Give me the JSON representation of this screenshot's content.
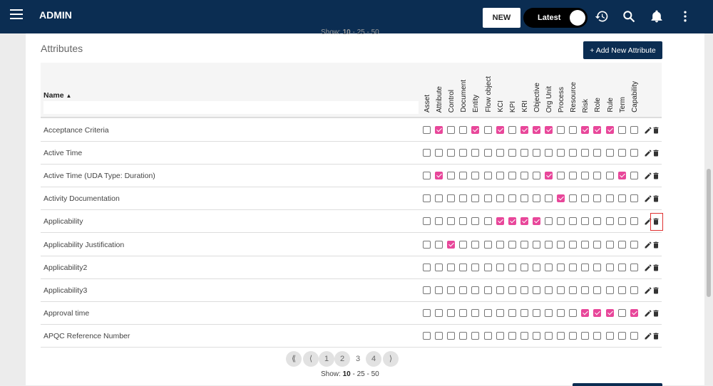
{
  "header": {
    "title": "ADMIN",
    "new_label": "NEW",
    "toggle_label": "Latest"
  },
  "section": {
    "title": "Attributes",
    "add_label": "+ Add New Attribute"
  },
  "table": {
    "name_header": "Name",
    "sort_indicator": "▲",
    "columns": [
      "Asset",
      "Attribute",
      "Control",
      "Document",
      "Entity",
      "Flow object",
      "KCI",
      "KPI",
      "KRI",
      "Objective",
      "Org Unit",
      "Process",
      "Resource",
      "Risk",
      "Role",
      "Rule",
      "Term",
      "Capability"
    ],
    "rows": [
      {
        "name": "Acceptance Criteria",
        "checks": [
          0,
          1,
          0,
          0,
          1,
          0,
          1,
          0,
          1,
          1,
          1,
          0,
          0,
          1,
          1,
          1,
          0,
          0
        ]
      },
      {
        "name": "Active Time",
        "checks": [
          0,
          0,
          0,
          0,
          0,
          0,
          0,
          0,
          0,
          0,
          0,
          0,
          0,
          0,
          0,
          0,
          0,
          0
        ]
      },
      {
        "name": "Active Time (UDA Type: Duration)",
        "checks": [
          0,
          1,
          0,
          0,
          0,
          0,
          0,
          0,
          0,
          0,
          1,
          0,
          0,
          0,
          0,
          0,
          1,
          0
        ]
      },
      {
        "name": "Activity Documentation",
        "checks": [
          0,
          0,
          0,
          0,
          0,
          0,
          0,
          0,
          0,
          0,
          0,
          1,
          0,
          0,
          0,
          0,
          0,
          0
        ]
      },
      {
        "name": "Applicability",
        "checks": [
          0,
          0,
          0,
          0,
          0,
          0,
          1,
          1,
          1,
          1,
          0,
          0,
          0,
          0,
          0,
          0,
          0,
          0
        ]
      },
      {
        "name": "Applicability Justification",
        "checks": [
          0,
          0,
          1,
          0,
          0,
          0,
          0,
          0,
          0,
          0,
          0,
          0,
          0,
          0,
          0,
          0,
          0,
          0
        ]
      },
      {
        "name": "Applicability2",
        "checks": [
          0,
          0,
          0,
          0,
          0,
          0,
          0,
          0,
          0,
          0,
          0,
          0,
          0,
          0,
          0,
          0,
          0,
          0
        ]
      },
      {
        "name": "Applicability3",
        "checks": [
          0,
          0,
          0,
          0,
          0,
          0,
          0,
          0,
          0,
          0,
          0,
          0,
          0,
          0,
          0,
          0,
          0,
          0
        ]
      },
      {
        "name": "Approval time",
        "checks": [
          0,
          0,
          0,
          0,
          0,
          0,
          0,
          0,
          0,
          0,
          0,
          0,
          0,
          1,
          1,
          1,
          0,
          1
        ]
      },
      {
        "name": "APQC Reference Number",
        "checks": [
          0,
          0,
          0,
          0,
          0,
          0,
          0,
          0,
          0,
          0,
          0,
          0,
          0,
          0,
          0,
          0,
          0,
          0
        ]
      }
    ]
  },
  "pagination": {
    "first": "⟪",
    "prev": "⟨",
    "pages": [
      "1",
      "2",
      "3",
      "4"
    ],
    "current_page": "3",
    "next": "⟩",
    "show_label": "Show:",
    "sizes": [
      "10",
      "25",
      "50"
    ],
    "selected_size": "10"
  },
  "colors": {
    "header_bg": "#0b2d52",
    "checked": "#e8479a"
  }
}
